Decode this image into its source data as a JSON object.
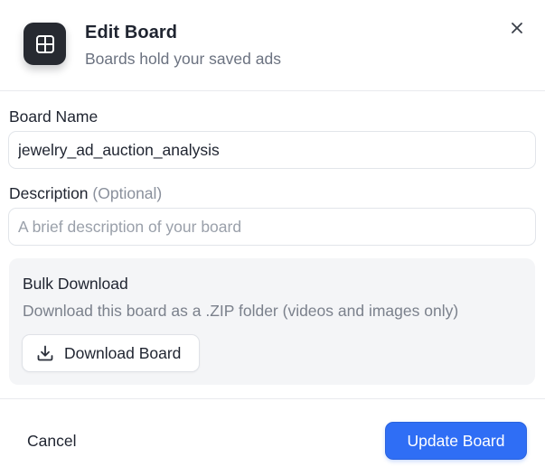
{
  "header": {
    "title": "Edit Board",
    "subtitle": "Boards hold your saved ads",
    "icon": "board-layout-icon",
    "close_icon": "close-icon"
  },
  "form": {
    "board_name": {
      "label": "Board Name",
      "value": "jewelry_ad_auction_analysis"
    },
    "description": {
      "label": "Description",
      "optional_tag": "(Optional)",
      "value": "",
      "placeholder": "A brief description of your board"
    }
  },
  "bulk_download": {
    "title": "Bulk Download",
    "description": "Download this board as a .ZIP folder (videos and images only)",
    "button_label": "Download Board",
    "button_icon": "download-icon"
  },
  "footer": {
    "cancel_label": "Cancel",
    "submit_label": "Update Board"
  },
  "colors": {
    "accent": "#2f6ef5",
    "icon_tile": "#272a31",
    "panel_bg": "#f4f5f7"
  }
}
